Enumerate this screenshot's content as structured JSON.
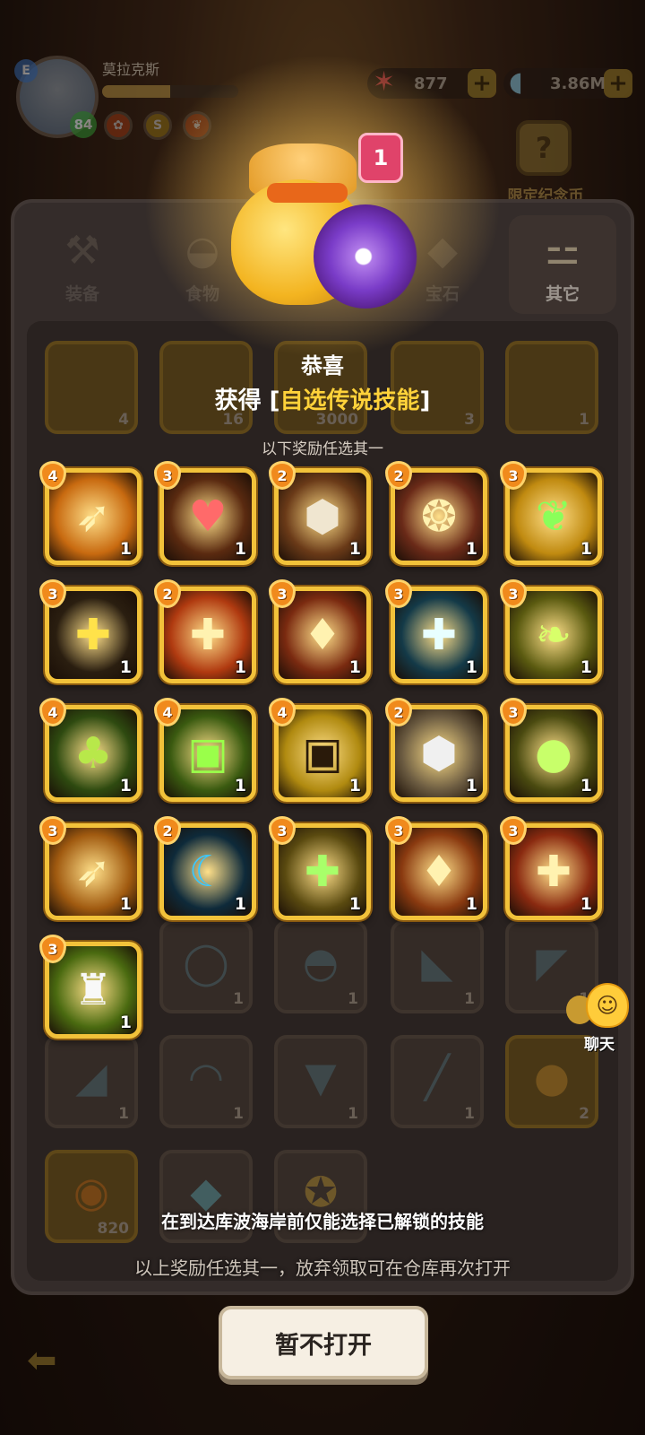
{
  "player": {
    "name": "莫拉克斯",
    "level": "84",
    "badge": "E",
    "xp_progress": 0.5
  },
  "currencies": [
    {
      "icon": "starfish-icon",
      "value": "877"
    },
    {
      "icon": "shell-icon",
      "value": "3.86M"
    }
  ],
  "event_badge": {
    "label": "限定纪念币"
  },
  "tabs": [
    {
      "label": "装备",
      "icon": "equipment-icon",
      "active": false
    },
    {
      "label": "食物",
      "icon": "food-icon",
      "active": false
    },
    {
      "label": "宝石",
      "icon": "gem-icon",
      "active": false
    },
    {
      "label": "其它",
      "icon": "bone-icon",
      "active": true
    }
  ],
  "inventory_counts": [
    "4",
    "16",
    "3000",
    "3",
    "1",
    "1",
    "1",
    "1",
    "1",
    "1",
    "1",
    "1",
    "1",
    "2",
    "820"
  ],
  "reward": {
    "count": "1",
    "congrats": "恭喜",
    "obtained_prefix": "获得",
    "bracket_open": "[",
    "item_name": "自选传说技能",
    "bracket_close": "]",
    "instruction": "以下奖励任选其一"
  },
  "skills": [
    {
      "tier": "4",
      "count": "1",
      "icon": "feathers-icon",
      "bg": "#c86a10"
    },
    {
      "tier": "3",
      "count": "1",
      "icon": "heart-sprout-icon",
      "bg": "#5a2a10"
    },
    {
      "tier": "2",
      "count": "1",
      "icon": "owl-icon",
      "bg": "#6a3a18"
    },
    {
      "tier": "2",
      "count": "1",
      "icon": "spiral-heal-icon",
      "bg": "#6a2a18"
    },
    {
      "tier": "3",
      "count": "1",
      "icon": "sprout-glow-icon",
      "bg": "#c08a10"
    },
    {
      "tier": "3",
      "count": "1",
      "icon": "shield-cross-icon",
      "bg": "#2a1e10"
    },
    {
      "tier": "2",
      "count": "1",
      "icon": "cross-burst-icon",
      "bg": "#b03a10"
    },
    {
      "tier": "3",
      "count": "1",
      "icon": "flame-drop-icon",
      "bg": "#7a2a10"
    },
    {
      "tier": "3",
      "count": "1",
      "icon": "cyan-cross-icon",
      "bg": "#143a48"
    },
    {
      "tier": "3",
      "count": "1",
      "icon": "leaf-glow-icon",
      "bg": "#5a5a10"
    },
    {
      "tier": "4",
      "count": "1",
      "icon": "tree-icon",
      "bg": "#2e4a10"
    },
    {
      "tier": "4",
      "count": "1",
      "icon": "robot-heal-icon",
      "bg": "#3a5a10"
    },
    {
      "tier": "4",
      "count": "1",
      "icon": "robot-shadow-icon",
      "bg": "#b08a10"
    },
    {
      "tier": "2",
      "count": "1",
      "icon": "owl-white-icon",
      "bg": "#6a5a40"
    },
    {
      "tier": "3",
      "count": "1",
      "icon": "seed-orb-icon",
      "bg": "#4a4a10"
    },
    {
      "tier": "3",
      "count": "1",
      "icon": "feather-slash-icon",
      "bg": "#a05a10"
    },
    {
      "tier": "2",
      "count": "1",
      "icon": "blue-crescent-icon",
      "bg": "#0e2a3a"
    },
    {
      "tier": "3",
      "count": "1",
      "icon": "green-cross-icon",
      "bg": "#5a4a10"
    },
    {
      "tier": "3",
      "count": "1",
      "icon": "candle-burst-icon",
      "bg": "#8a3a10"
    },
    {
      "tier": "3",
      "count": "1",
      "icon": "cross-rain-icon",
      "bg": "#8a2a10"
    },
    {
      "tier": "3",
      "count": "1",
      "icon": "chef-hat-icon",
      "bg": "#4a6a10"
    }
  ],
  "chat": {
    "label": "聊天"
  },
  "notice_locked": "在到达库波海岸前仅能选择已解锁的技能",
  "notice_reopen": "以上奖励任选其一，放弃领取可在仓库再次打开",
  "dont_open_button": "暂不打开",
  "colors": {
    "accent_gold": "#ffd23a",
    "tile_border": "#f2c23a",
    "tier_orange": "#f08a1c",
    "badge_pink": "#e0436a"
  }
}
